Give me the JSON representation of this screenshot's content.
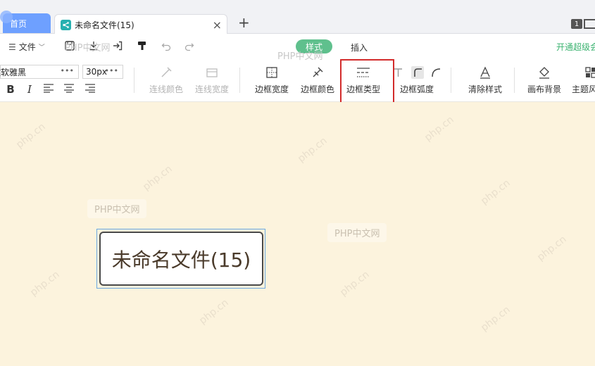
{
  "tabs": {
    "home_label": "首页",
    "doc_label": "未命名文件(15)",
    "close_symbol": "×",
    "add_symbol": "+",
    "window_count": "1"
  },
  "ribbon": {
    "file_label": "文件",
    "tab_style": "样式",
    "tab_insert": "插入",
    "vip_link": "开通超级会员",
    "font_family": "微软雅黑",
    "font_size": "30px",
    "tools": {
      "line_color": "连线颜色",
      "line_width": "连线宽度",
      "border_width": "边框宽度",
      "border_color": "边框颜色",
      "border_type": "边框类型",
      "border_radius": "边框弧度",
      "clear_style": "清除样式",
      "canvas_bg": "画布背景",
      "theme": "主题风格"
    }
  },
  "canvas": {
    "node_text": "未命名文件(15)",
    "watermark": "PHP中文网",
    "diag_watermark": "php.cn"
  },
  "colors": {
    "accent_green": "#5fc08d",
    "home_tab": "#6ea0ff",
    "canvas_bg": "#fcf3dd",
    "highlight_red": "#d22b2b"
  }
}
